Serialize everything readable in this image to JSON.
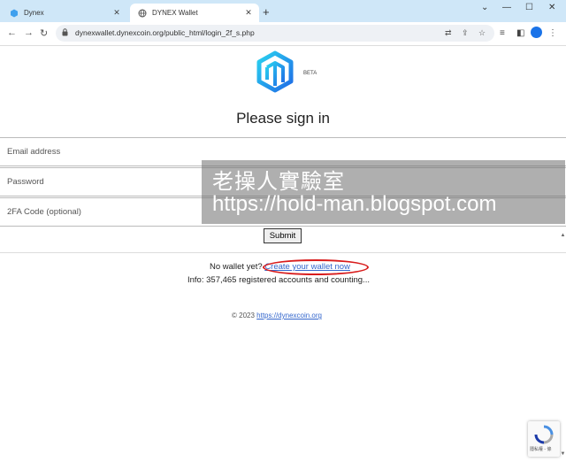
{
  "browser": {
    "tabs": [
      {
        "label": "Dynex",
        "active": false
      },
      {
        "label": "DYNEX Wallet",
        "active": true
      }
    ],
    "url": "dynexwallet.dynexcoin.org/public_html/login_2f_s.php"
  },
  "page": {
    "beta": "BETA",
    "heading": "Please sign in",
    "fields": {
      "email_placeholder": "Email address",
      "password_placeholder": "Password",
      "twofa_placeholder": "2FA Code (optional)"
    },
    "submit_label": "Submit",
    "no_wallet_text": "No wallet yet?",
    "create_link": "Create your wallet now",
    "info_text": "Info: 357,465 registered accounts and counting...",
    "copyright": "© 2023",
    "site_link": "https://dynexcoin.org"
  },
  "watermark": {
    "line1": "老操人實驗室",
    "line2": "https://hold-man.blogspot.com"
  },
  "recaptcha": {
    "label": "隱私權 - 條"
  },
  "colors": {
    "accent_link": "#3366cc",
    "annotation_ring": "#d81c1c",
    "logo_gradient": [
      "#2ad3f0",
      "#1f6be6"
    ]
  }
}
